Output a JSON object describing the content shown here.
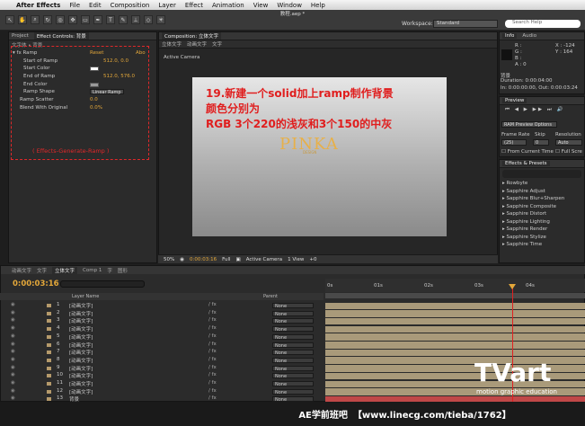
{
  "menu": {
    "app": "After Effects",
    "items": [
      "File",
      "Edit",
      "Composition",
      "Layer",
      "Effect",
      "Animation",
      "View",
      "Window",
      "Help"
    ],
    "doc_title": "教程.aep *"
  },
  "toolbar": {
    "workspace_label": "Workspace:",
    "workspace_value": "Standard",
    "search_placeholder": "Search Help"
  },
  "effects_panel": {
    "tabs": [
      "Project",
      "Effect Controls: 背景"
    ],
    "sub": "文字体 • 背景",
    "effect_name": "Ramp",
    "reset": "Reset",
    "about": "Abo",
    "properties": [
      {
        "name": "Start of Ramp",
        "value": "512.0, 0.0"
      },
      {
        "name": "Start Color",
        "value": ""
      },
      {
        "name": "End of Ramp",
        "value": "512.0, 576.0"
      },
      {
        "name": "End Color",
        "value": ""
      },
      {
        "name": "Ramp Shape",
        "value": "Linear Ramp"
      },
      {
        "name": "Ramp Scatter",
        "value": "0.0"
      },
      {
        "name": "Blend With Original",
        "value": "0.0%"
      }
    ],
    "annotation": "( Effects-Generate-Ramp )"
  },
  "comp_panel": {
    "tab": "Composition: 立体文字",
    "breadcrumbs": [
      "立体文字",
      "动画文字",
      "文字"
    ],
    "active_camera": "Active Camera",
    "annotation_lines": [
      "19.新建一个solid加上ramp制作背景",
      "颜色分别为",
      "RGB 3个220的浅灰和3个150的中灰"
    ],
    "logo": "PINKA",
    "logo_sub": "DESIGN",
    "footer": {
      "zoom": "50%",
      "time": "0:00:03:16",
      "resolution": "Full",
      "camera": "Active Camera",
      "view": "1 View",
      "offset": "+0"
    }
  },
  "info_panel": {
    "tabs": [
      "Info",
      "Audio"
    ],
    "r": "R :",
    "g": "G :",
    "b": "B :",
    "a": "A : 0",
    "x": "X : -124",
    "y": "Y : 164",
    "layer": "背景",
    "duration": "Duration: 0:00:04:00",
    "inout": "In: 0:00:00:00, Out: 0:00:03:24"
  },
  "preview_panel": {
    "tab": "Preview",
    "ram": "RAM Preview Options",
    "frame_rate_label": "Frame Rate",
    "skip_label": "Skip",
    "resolution_label": "Resolution",
    "frame_rate": "(25)",
    "skip": "0",
    "resolution": "Auto",
    "from_current": "From Current Time",
    "full_screen": "Full Scre"
  },
  "fx_panel": {
    "tab": "Effects & Presets",
    "items": [
      "Rowbyte",
      "Sapphire Adjust",
      "Sapphire Blur+Sharpen",
      "Sapphire Composite",
      "Sapphire Distort",
      "Sapphire Lighting",
      "Sapphire Render",
      "Sapphire Stylize",
      "Sapphire Time"
    ]
  },
  "timeline": {
    "tabs": [
      "动画文字",
      "文字",
      "立体文字",
      "Comp 1",
      "字",
      "图形"
    ],
    "timecode": "0:00:03:16",
    "columns": {
      "layer_name": "Layer Name",
      "parent": "Parent"
    },
    "ticks": [
      "0s",
      "01s",
      "02s",
      "03s",
      "04s"
    ],
    "layers": [
      {
        "num": "1",
        "name": "[动画文字]",
        "parent": "None"
      },
      {
        "num": "2",
        "name": "[动画文字]",
        "parent": "None"
      },
      {
        "num": "3",
        "name": "[动画文字]",
        "parent": "None"
      },
      {
        "num": "4",
        "name": "[动画文字]",
        "parent": "None"
      },
      {
        "num": "5",
        "name": "[动画文字]",
        "parent": "None"
      },
      {
        "num": "6",
        "name": "[动画文字]",
        "parent": "None"
      },
      {
        "num": "7",
        "name": "[动画文字]",
        "parent": "None"
      },
      {
        "num": "8",
        "name": "[动画文字]",
        "parent": "None"
      },
      {
        "num": "9",
        "name": "[动画文字]",
        "parent": "None"
      },
      {
        "num": "10",
        "name": "[动画文字]",
        "parent": "None"
      },
      {
        "num": "11",
        "name": "[动画文字]",
        "parent": "None"
      },
      {
        "num": "12",
        "name": "[动画文字]",
        "parent": "None"
      },
      {
        "num": "13",
        "name": "背景",
        "parent": "None"
      }
    ]
  },
  "watermark": {
    "brand": "TVart",
    "brand_sub": "motion graphic education",
    "footer_left": "AE学前班吧",
    "footer_right": "【www.linecg.com/tieba/1762】"
  }
}
